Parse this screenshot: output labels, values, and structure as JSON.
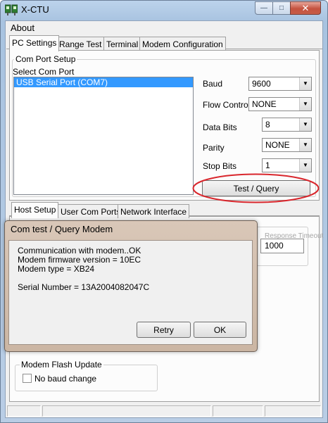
{
  "window": {
    "title": "X-CTU"
  },
  "menu": {
    "about": "About"
  },
  "tabs": [
    {
      "label": "PC Settings"
    },
    {
      "label": "Range Test"
    },
    {
      "label": "Terminal"
    },
    {
      "label": "Modem Configuration"
    }
  ],
  "com_port_setup": {
    "group_label": "Com Port Setup",
    "list_label": "Select Com Port",
    "ports": [
      "USB Serial Port (COM7)"
    ]
  },
  "settings": {
    "baud": {
      "label": "Baud",
      "value": "9600"
    },
    "flow_control": {
      "label": "Flow Control",
      "value": "NONE"
    },
    "data_bits": {
      "label": "Data Bits",
      "value": "8"
    },
    "parity": {
      "label": "Parity",
      "value": "NONE"
    },
    "stop_bits": {
      "label": "Stop Bits",
      "value": "1"
    },
    "test_query_label": "Test  / Query"
  },
  "sub_tabs": [
    {
      "label": "Host Setup"
    },
    {
      "label": "User Com Ports"
    },
    {
      "label": "Network Interface"
    }
  ],
  "host_setup": {
    "background_group_label": "Response Timeout",
    "timeout_value": "1000",
    "flash_group_label": "Modem Flash Update",
    "no_baud_change_label": "No baud change"
  },
  "dialog": {
    "title": "Com test / Query Modem",
    "lines": [
      "Communication with modem..OK",
      "Modem firmware version = 10EC",
      "Modem type = XB24",
      "Serial Number = 13A2004082047C"
    ],
    "retry_label": "Retry",
    "ok_label": "OK"
  },
  "colors": {
    "selection": "#3399ff",
    "annotation": "#d9262c"
  }
}
